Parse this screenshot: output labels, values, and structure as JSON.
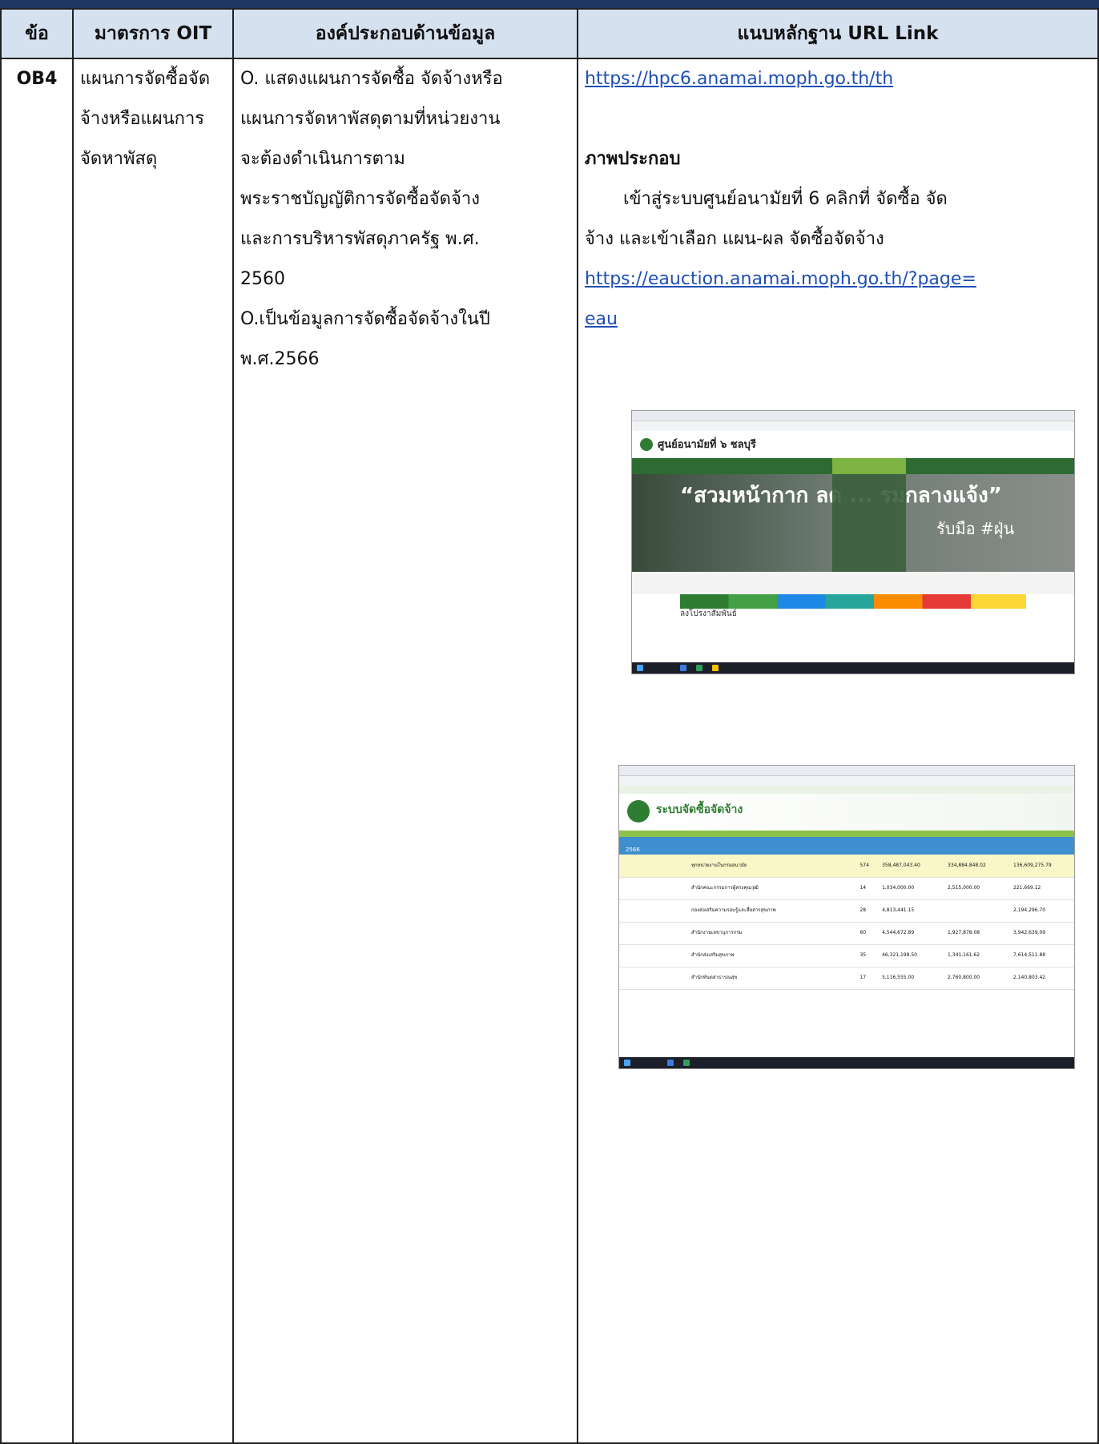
{
  "table": {
    "headers": [
      "ข้อ",
      "มาตรการ OIT",
      "องค์ประกอบด้านข้อมูล",
      "แนบหลักฐาน URL Link"
    ],
    "row": {
      "code": "OB4",
      "measure_lines": [
        "แผนการจัดซื้อจัด",
        "จ้างหรือแผนการ",
        "จัดหาพัสดุ"
      ],
      "component_lines": [
        "O. แสดงแผนการจัดซื้อ จัดจ้างหรือ",
        "แผนการจัดหาพัสดุตามที่หน่วยงาน",
        "จะต้องดำเนินการตาม",
        "พระราชบัญญัติการจัดซื้อจัดจ้าง",
        "และการบริหารพัสดุภาครัฐ พ.ศ.",
        "2560",
        "O.เป็นข้อมูลการจัดซื้อจัดจ้างในปี",
        "พ.ศ.2566"
      ],
      "evidence": {
        "link1": "https://hpc6.anamai.moph.go.th/th",
        "illustration_heading": "ภาพประกอบ",
        "desc_line1": "เข้าสู่ระบบศูนย์อนามัยที่ 6 คลิกที่ จัดซื้อ จัด",
        "desc_line2": "จ้าง และเข้าเลือก แผน-ผล จัดซื้อจัดจ้าง",
        "link2_line1": "https://eauction.anamai.moph.go.th/?page=",
        "link2_line2": "eau"
      }
    }
  },
  "screenshot1": {
    "site_title": "ศูนย์อนามัยที่ ๖ ชลบุรี",
    "banner_text": "“สวมหน้ากาก ลด ... รมกลางแจ้ง”",
    "banner_side": "รับมือ #ฝุ่น",
    "section": "ลงโปรงาสัมพันธ์"
  },
  "screenshot2": {
    "system_title": "ระบบจัดซื้อจัดจ้าง",
    "year": "2566",
    "rows": [
      {
        "name": "ทุกหน่วยงานในกรมอนามัย",
        "count": "574",
        "a": "358,487,043.40",
        "b": "334,884,848.02",
        "c": "136,609,275.79"
      },
      {
        "name": "สำนักคณะกรรมการผู้ทรงคุณวุฒิ",
        "count": "14",
        "a": "1,034,000.00",
        "b": "2,515,000.00",
        "c": "221,669.12"
      },
      {
        "name": "กองส่งเสริมความรอบรู้และสื่อสารสุขภาพ",
        "count": "28",
        "a": "4,813,441.15",
        "b": "",
        "c": "2,194,296.70"
      },
      {
        "name": "สำนักงานเลขานุการกรม",
        "count": "60",
        "a": "4,544,672.89",
        "b": "1,927,878.08",
        "c": "3,942,639.09"
      },
      {
        "name": "สำนักส่งเสริมสุขภาพ",
        "count": "35",
        "a": "46,321,198.50",
        "b": "1,341,161.62",
        "c": "7,614,511.88"
      },
      {
        "name": "สำนักทันตสาธารณสุข",
        "count": "17",
        "a": "5,116,555.00",
        "b": "2,760,800.00",
        "c": "2,140,803.42"
      }
    ]
  },
  "colors": {
    "header_bg": "#d6e1f0",
    "top_band": "#1f3864",
    "link": "#1f4fb5"
  }
}
